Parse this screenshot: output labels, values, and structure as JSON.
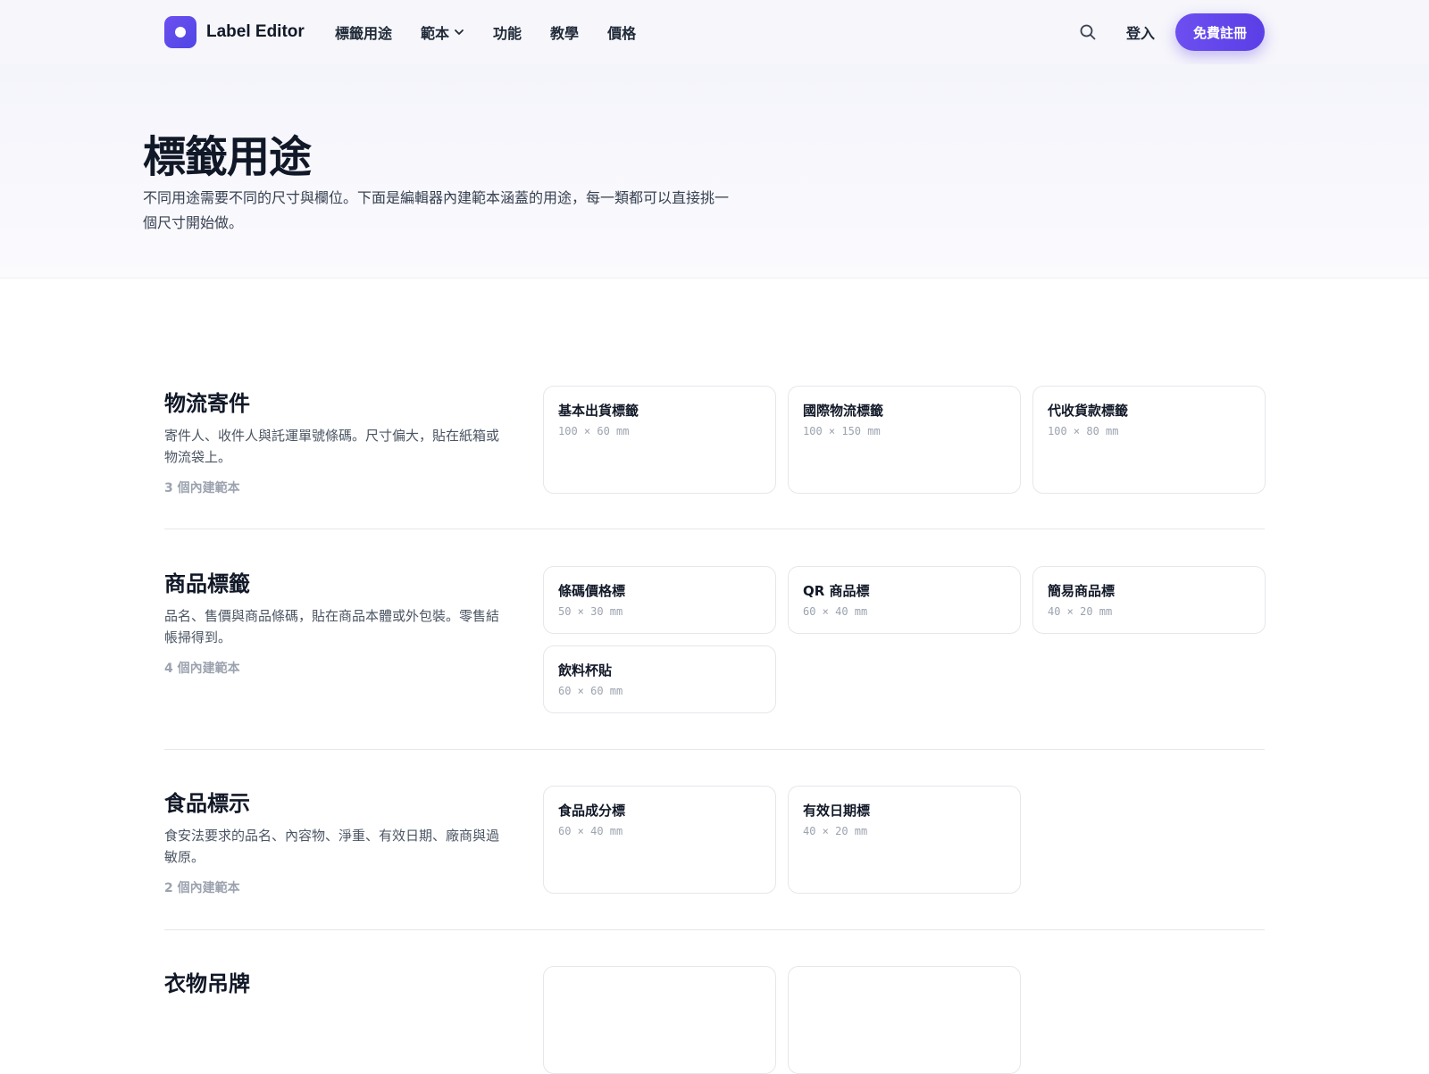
{
  "header": {
    "brand": "Label Editor",
    "nav": [
      "標籤用途",
      "範本",
      "功能",
      "教學",
      "價格"
    ],
    "login": "登入",
    "signup": "免費註冊"
  },
  "hero": {
    "title": "標籤用途",
    "description": "不同用途需要不同的尺寸與欄位。下面是編輯器內建範本涵蓋的用途，每一類都可以直接挑一個尺寸開始做。"
  },
  "sections": [
    {
      "title": "物流寄件",
      "description": "寄件人、收件人與託運單號條碼。尺寸偏大，貼在紙箱或物流袋上。",
      "count": "3 個內建範本",
      "templates": [
        {
          "name": "基本出貨標籤",
          "size": "100 × 60 mm"
        },
        {
          "name": "國際物流標籤",
          "size": "100 × 150 mm"
        },
        {
          "name": "代收貨款標籤",
          "size": "100 × 80 mm"
        }
      ]
    },
    {
      "title": "商品標籤",
      "description": "品名、售價與商品條碼，貼在商品本體或外包裝。零售結帳掃得到。",
      "count": "4 個內建範本",
      "templates": [
        {
          "name": "條碼價格標",
          "size": "50 × 30 mm"
        },
        {
          "name": "QR 商品標",
          "size": "60 × 40 mm"
        },
        {
          "name": "簡易商品標",
          "size": "40 × 20 mm"
        },
        {
          "name": "飲料杯貼",
          "size": "60 × 60 mm"
        }
      ]
    },
    {
      "title": "食品標示",
      "description": "食安法要求的品名、內容物、淨重、有效日期、廠商與過敏原。",
      "count": "2 個內建範本",
      "templates": [
        {
          "name": "食品成分標",
          "size": "60 × 40 mm"
        },
        {
          "name": "有效日期標",
          "size": "40 × 20 mm"
        }
      ]
    },
    {
      "title": "衣物吊牌"
    }
  ],
  "colors": {
    "accent": "#5b3fe6",
    "text": "#111827",
    "muted": "#9ca3af",
    "border": "#e5e7eb"
  },
  "icons": {
    "logo": "circle-dot-logo",
    "dropdown": "chevron-down-icon",
    "search": "search-icon"
  }
}
